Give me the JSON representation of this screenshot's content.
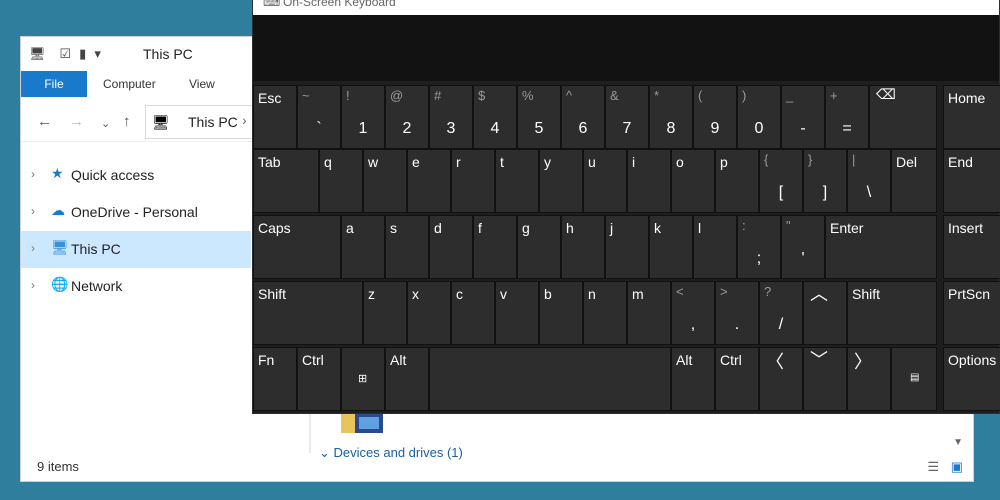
{
  "explorer": {
    "title": "This PC",
    "qat_icons": [
      "pc-icon",
      "properties-icon",
      "new-folder-icon",
      "dropdown-icon"
    ],
    "tabs": {
      "file": "File",
      "computer": "Computer",
      "view": "View"
    },
    "address": {
      "location": "This PC"
    },
    "nav_items": [
      {
        "label": "Quick access",
        "icon": "star-icon",
        "selected": false
      },
      {
        "label": "OneDrive - Personal",
        "icon": "cloud-icon",
        "selected": false
      },
      {
        "label": "This PC",
        "icon": "pc-icon",
        "selected": true
      },
      {
        "label": "Network",
        "icon": "network-icon",
        "selected": false
      }
    ],
    "section_header": "Devices and drives (1)",
    "status_text": "9 items",
    "accent": "#1979ca",
    "selection_color": "#cce8ff"
  },
  "osk": {
    "title": "On-Screen Keyboard",
    "keys": {
      "esc": "Esc",
      "tilde": "~",
      "backtick": "`",
      "excl": "!",
      "one": "1",
      "at": "@",
      "two": "2",
      "hash": "#",
      "three": "3",
      "dollar": "$",
      "four": "4",
      "percent": "%",
      "five": "5",
      "caret": "^",
      "six": "6",
      "amp": "&",
      "seven": "7",
      "star": "*",
      "eight": "8",
      "lparen": "(",
      "nine": "9",
      "rparen": ")",
      "zero": "0",
      "underscore": "_",
      "minus": "-",
      "plus": "+",
      "equals": "=",
      "home": "Home",
      "tab": "Tab",
      "q": "q",
      "w": "w",
      "e": "e",
      "r": "r",
      "t": "t",
      "y": "y",
      "u": "u",
      "i": "i",
      "o": "o",
      "p": "p",
      "lbrace": "{",
      "lbracket": "[",
      "rbrace": "}",
      "rbracket": "]",
      "pipe": "|",
      "backslash": "\\",
      "del": "Del",
      "end": "End",
      "caps": "Caps",
      "a": "a",
      "s": "s",
      "d": "d",
      "f": "f",
      "g": "g",
      "h": "h",
      "j": "j",
      "k": "k",
      "l": "l",
      "colon": ":",
      "semicolon": ";",
      "dquote": "\"",
      "squote": "'",
      "enter": "Enter",
      "insert": "Insert",
      "shift": "Shift",
      "z": "z",
      "x": "x",
      "c": "c",
      "v": "v",
      "b": "b",
      "n": "n",
      "m": "m",
      "lt": "<",
      "comma": ",",
      "gt": ">",
      "period": ".",
      "question": "?",
      "slash": "/",
      "prtscn": "PrtScn",
      "fn": "Fn",
      "ctrl": "Ctrl",
      "alt": "Alt",
      "options": "Options"
    },
    "background": "#1e1e1e",
    "key_color": "#2d2d2d"
  }
}
